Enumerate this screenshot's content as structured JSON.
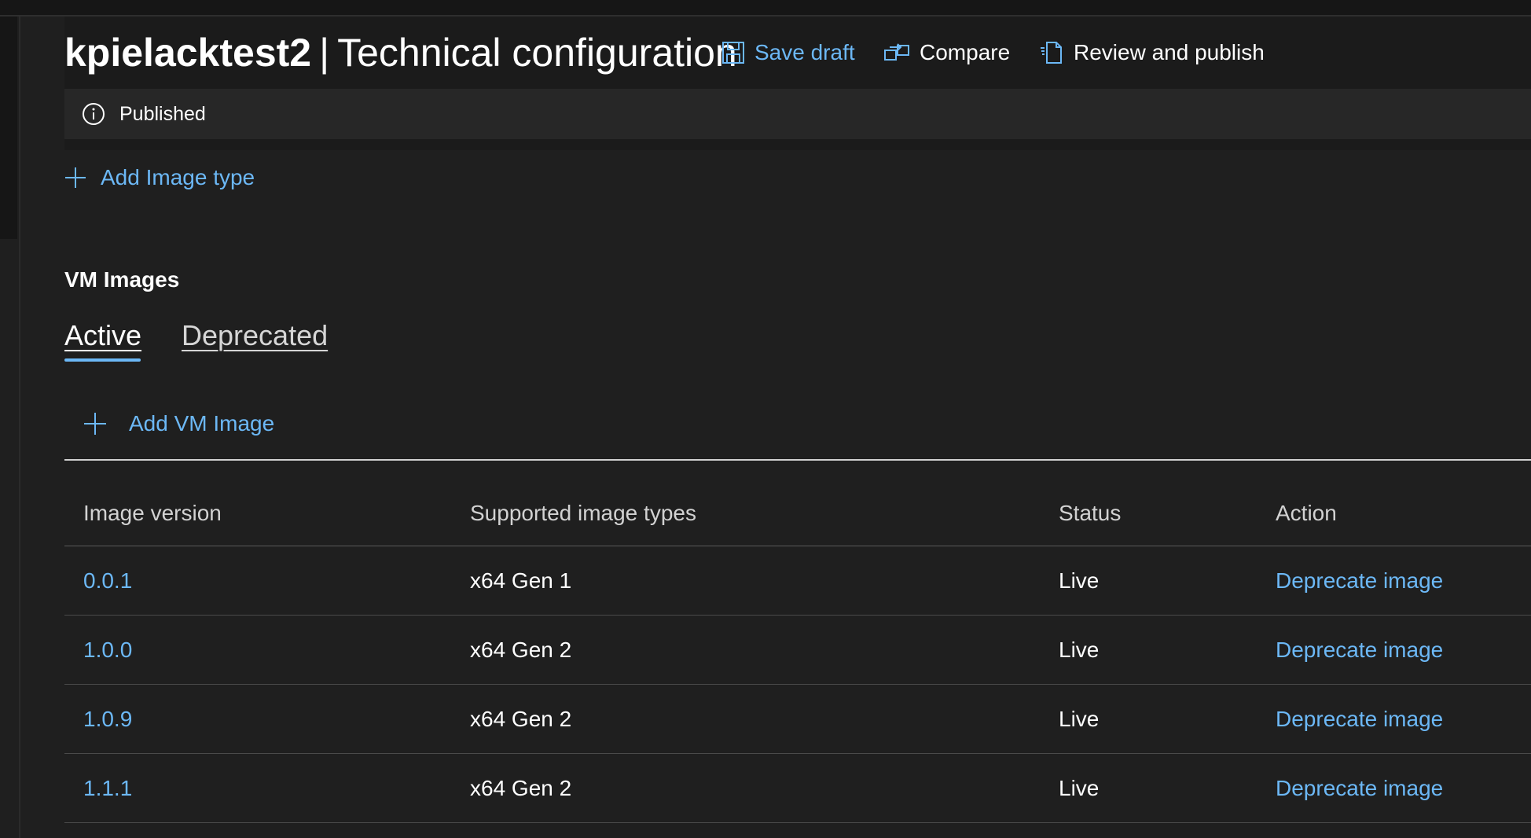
{
  "header": {
    "title_name": "kpielacktest2",
    "title_separator": "|",
    "title_section": "Technical configuration",
    "commands": {
      "save_draft": "Save draft",
      "compare": "Compare",
      "review_publish": "Review and publish"
    }
  },
  "status": {
    "text": "Published",
    "icon": "info-icon"
  },
  "actions": {
    "add_image_type": "Add Image type",
    "add_vm_image": "Add VM Image"
  },
  "vm_images": {
    "heading": "VM Images",
    "tabs": [
      {
        "label": "Active",
        "selected": true
      },
      {
        "label": "Deprecated",
        "selected": false
      }
    ],
    "columns": [
      "Image version",
      "Supported image types",
      "Status",
      "Action"
    ],
    "rows": [
      {
        "version": "0.0.1",
        "types": "x64 Gen 1",
        "status": "Live",
        "action": "Deprecate image"
      },
      {
        "version": "1.0.0",
        "types": "x64 Gen 2",
        "status": "Live",
        "action": "Deprecate image"
      },
      {
        "version": "1.0.9",
        "types": "x64 Gen 2",
        "status": "Live",
        "action": "Deprecate image"
      },
      {
        "version": "1.1.1",
        "types": "x64 Gen 2",
        "status": "Live",
        "action": "Deprecate image"
      }
    ]
  },
  "colors": {
    "background": "#1f1f1f",
    "accent": "#6cb8f6",
    "text": "#ffffff"
  }
}
